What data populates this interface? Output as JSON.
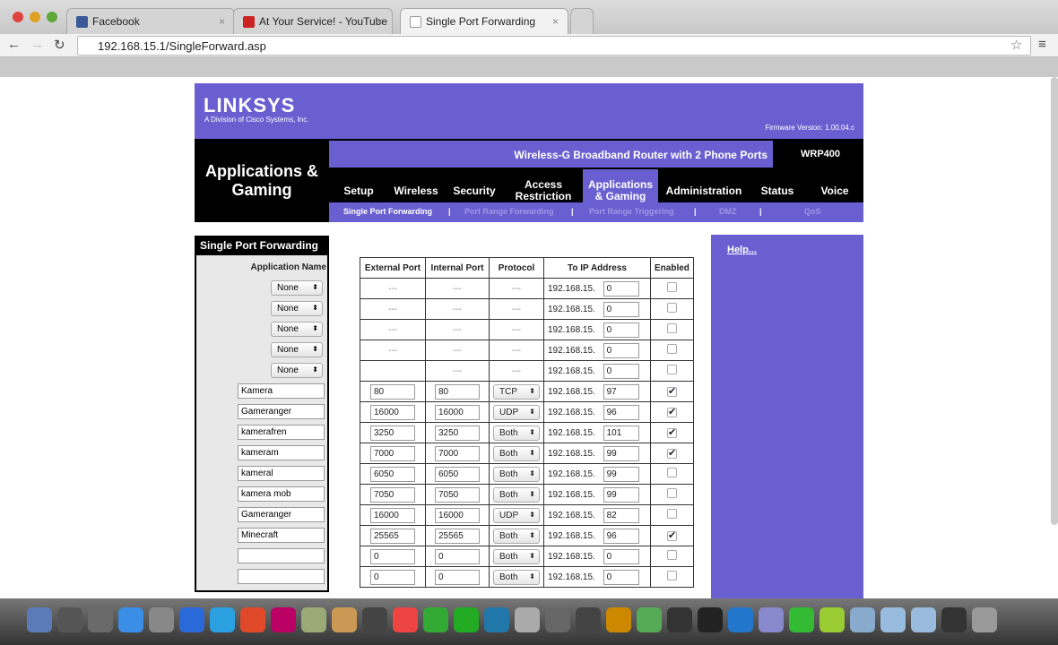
{
  "browser": {
    "tabs": [
      {
        "label": "Facebook",
        "color": "#3b5998"
      },
      {
        "label": "At Your Service! - YouTube",
        "color": "#cc2222"
      },
      {
        "label": "Single Port Forwarding",
        "color": "#ffffff"
      }
    ],
    "url": "192.168.15.1/SingleForward.asp"
  },
  "header": {
    "logo": "LINKSYS",
    "logo_sub": "A Division of Cisco Systems, Inc.",
    "firmware": "Firmware Version: 1.00.04.c",
    "section": "Applications & Gaming",
    "product": "Wireless-G Broadband Router with 2 Phone Ports",
    "model": "WRP400"
  },
  "nav": [
    "Setup",
    "Wireless",
    "Security",
    "Access Restriction",
    "Applications & Gaming",
    "Administration",
    "Status",
    "Voice"
  ],
  "subnav": [
    "Single Port Forwarding",
    "Port Range Forwarding",
    "Port Range Triggering",
    "DMZ",
    "QoS"
  ],
  "sidebar": {
    "title": "Single Port Forwarding",
    "app_label": "Application Name"
  },
  "help": "Help...",
  "table": {
    "headers": [
      "External Port",
      "Internal Port",
      "Protocol",
      "To IP Address",
      "Enabled"
    ],
    "ip_prefix": "192.168.15.",
    "rows": [
      {
        "name": "None",
        "type": "select",
        "ext": "---",
        "int": "---",
        "proto": "---",
        "ip": "0",
        "enabled": false
      },
      {
        "name": "None",
        "type": "select",
        "ext": "---",
        "int": "---",
        "proto": "---",
        "ip": "0",
        "enabled": false
      },
      {
        "name": "None",
        "type": "select",
        "ext": "---",
        "int": "---",
        "proto": "---",
        "ip": "0",
        "enabled": false
      },
      {
        "name": "None",
        "type": "select",
        "ext": "---",
        "int": "---",
        "proto": "---",
        "ip": "0",
        "enabled": false
      },
      {
        "name": "None",
        "type": "select",
        "ext": "",
        "int": "---",
        "proto": "---",
        "ip": "0",
        "enabled": false
      },
      {
        "name": "Kamera",
        "type": "text",
        "ext": "80",
        "int": "80",
        "proto": "TCP",
        "ip": "97",
        "enabled": true
      },
      {
        "name": "Gameranger",
        "type": "text",
        "ext": "16000",
        "int": "16000",
        "proto": "UDP",
        "ip": "96",
        "enabled": true
      },
      {
        "name": "kamerafren",
        "type": "text",
        "ext": "3250",
        "int": "3250",
        "proto": "Both",
        "ip": "101",
        "enabled": true
      },
      {
        "name": "kameram",
        "type": "text",
        "ext": "7000",
        "int": "7000",
        "proto": "Both",
        "ip": "99",
        "enabled": true
      },
      {
        "name": "kameral",
        "type": "text",
        "ext": "6050",
        "int": "6050",
        "proto": "Both",
        "ip": "99",
        "enabled": false
      },
      {
        "name": "kamera mob",
        "type": "text",
        "ext": "7050",
        "int": "7050",
        "proto": "Both",
        "ip": "99",
        "enabled": false
      },
      {
        "name": "Gameranger",
        "type": "text",
        "ext": "16000",
        "int": "16000",
        "proto": "UDP",
        "ip": "82",
        "enabled": false
      },
      {
        "name": "Minecraft",
        "type": "text",
        "ext": "25565",
        "int": "25565",
        "proto": "Both",
        "ip": "96",
        "enabled": true
      },
      {
        "name": "",
        "type": "text",
        "ext": "0",
        "int": "0",
        "proto": "Both",
        "ip": "0",
        "enabled": false
      },
      {
        "name": "",
        "type": "text",
        "ext": "0",
        "int": "0",
        "proto": "Both",
        "ip": "0",
        "enabled": false
      }
    ]
  }
}
